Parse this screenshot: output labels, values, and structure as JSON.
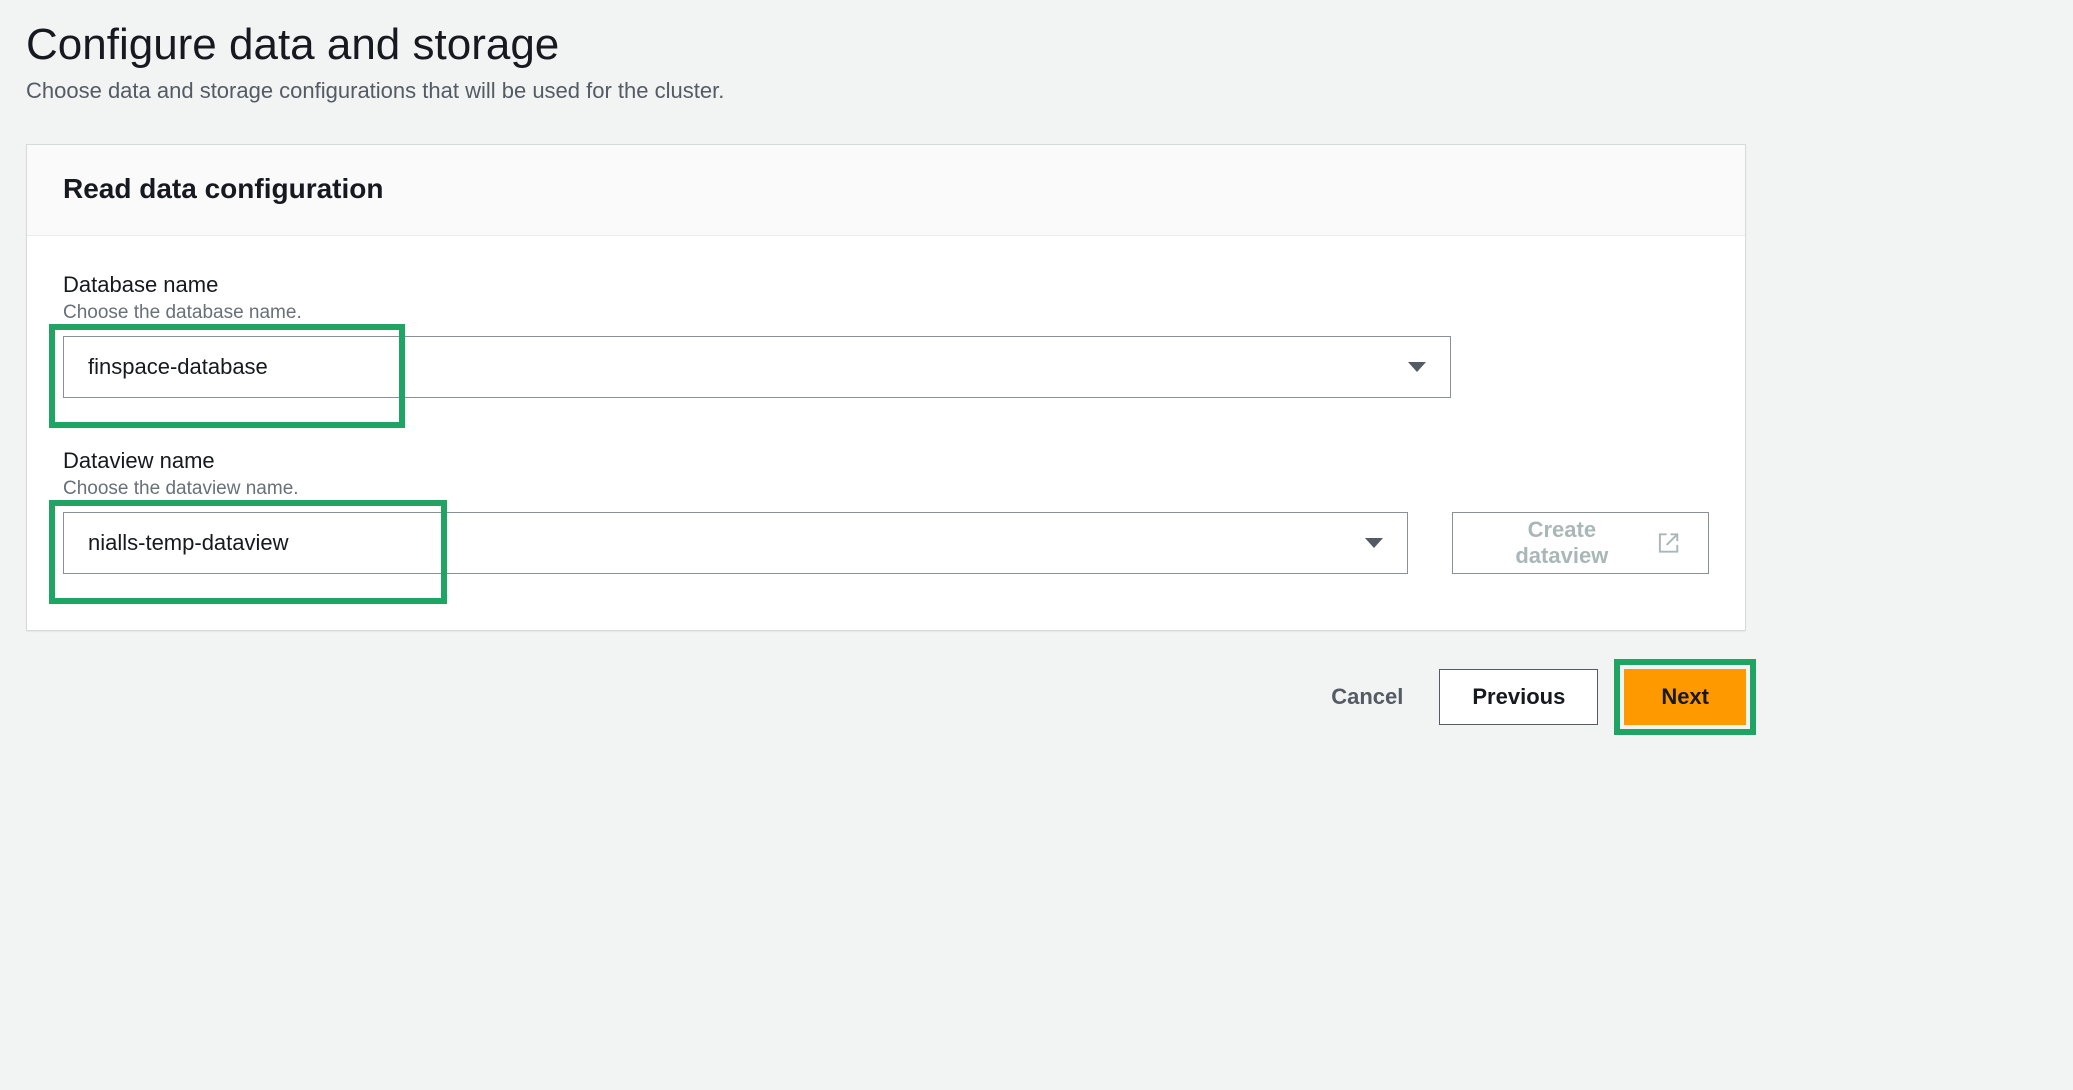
{
  "header": {
    "title": "Configure data and storage",
    "subtitle": "Choose data and storage configurations that will be used for the cluster."
  },
  "panel": {
    "title": "Read data configuration",
    "database": {
      "label": "Database name",
      "hint": "Choose the database name.",
      "value": "finspace-database"
    },
    "dataview": {
      "label": "Dataview name",
      "hint": "Choose the dataview name.",
      "value": "nialls-temp-dataview",
      "create_button": "Create dataview"
    }
  },
  "actions": {
    "cancel": "Cancel",
    "previous": "Previous",
    "next": "Next"
  }
}
